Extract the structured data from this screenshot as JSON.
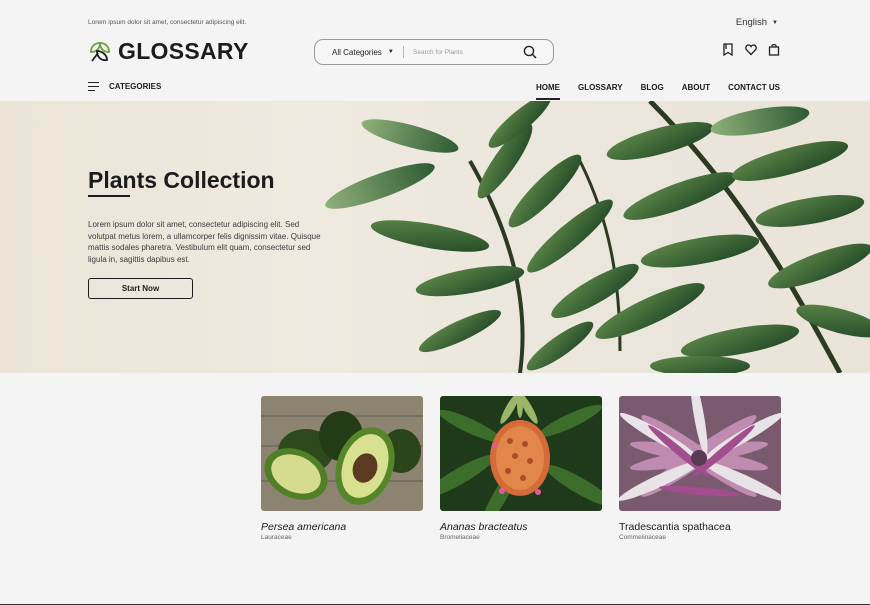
{
  "topbar": {
    "tagline": "Lorem ipsum dolor sit amet, consectetur adipiscing elit."
  },
  "language": {
    "selected": "English"
  },
  "brand": {
    "name": "GLOSSARY",
    "accent": "#6aa23a"
  },
  "search": {
    "category": "All Categories",
    "placeholder": "Search for Plants"
  },
  "header_icons": [
    "bookmark-icon",
    "heart-icon",
    "shopping-bag-icon"
  ],
  "categories_menu": {
    "label": "CATEGORIES"
  },
  "nav": {
    "items": [
      {
        "label": "HOME",
        "active": true
      },
      {
        "label": "GLOSSARY",
        "active": false
      },
      {
        "label": "BLOG",
        "active": false
      },
      {
        "label": "ABOUT",
        "active": false
      },
      {
        "label": "CONTACT US",
        "active": false
      }
    ]
  },
  "hero": {
    "title": "Plants Collection",
    "description": "Lorem ipsum dolor sit amet, consectetur adipiscing elit. Sed volutpat metus lorem, a ullamcorper felis dignissim vitae. Quisque mattis sodales pharetra. Vestibulum elit quam, consectetur sed ligula in, sagittis dapibus est.",
    "button": "Start Now"
  },
  "cards": [
    {
      "name": "Persea americana",
      "family": "Lauraceae",
      "italic": true
    },
    {
      "name": "Ananas bracteatus",
      "family": "Bromeliaceae",
      "italic": true
    },
    {
      "name": "Tradescantia spathacea",
      "family": "Commelinaceae",
      "italic": false
    }
  ]
}
